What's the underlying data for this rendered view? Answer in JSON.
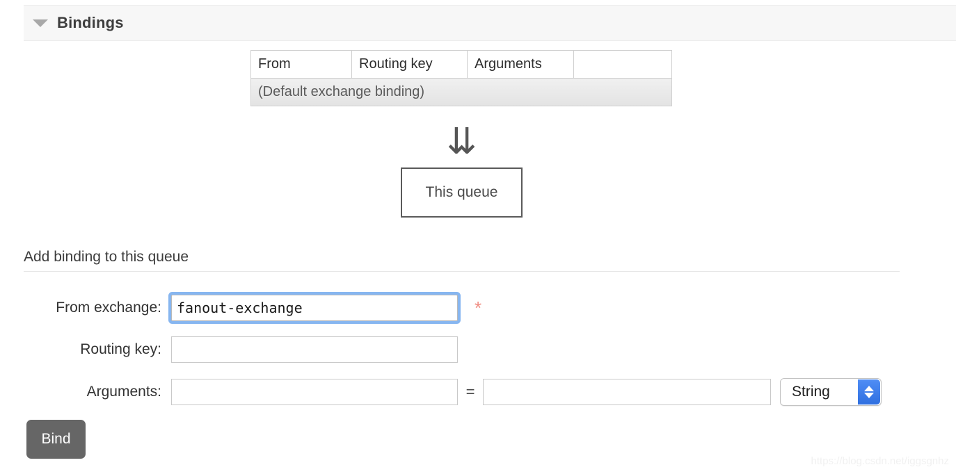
{
  "section": {
    "title": "Bindings",
    "caret_icon": "triangle-down-icon"
  },
  "bindings_table": {
    "columns": [
      "From",
      "Routing key",
      "Arguments",
      ""
    ],
    "rows": [
      {
        "message": "(Default exchange binding)"
      }
    ]
  },
  "diagram": {
    "arrow_icon": "double-down-arrow-icon",
    "arrow_glyph": "⇊",
    "queue_label": "This queue"
  },
  "form": {
    "heading": "Add binding to this queue",
    "from_exchange": {
      "label": "From exchange:",
      "value": "fanout-exchange",
      "placeholder": "",
      "required_marker": "*"
    },
    "routing_key": {
      "label": "Routing key:",
      "value": "",
      "placeholder": ""
    },
    "arguments": {
      "label": "Arguments:",
      "key_value": "",
      "key_placeholder": "",
      "equals": "=",
      "value_value": "",
      "value_placeholder": "",
      "type_selected": "String"
    },
    "submit_label": "Bind"
  },
  "watermark": "https://blog.csdn.net/iggsgnhz",
  "colors": {
    "focus_ring": "#87b6f0",
    "required_star": "#f08c82",
    "stepper_blue": "#2f6fe0",
    "button_gray": "#666666"
  }
}
